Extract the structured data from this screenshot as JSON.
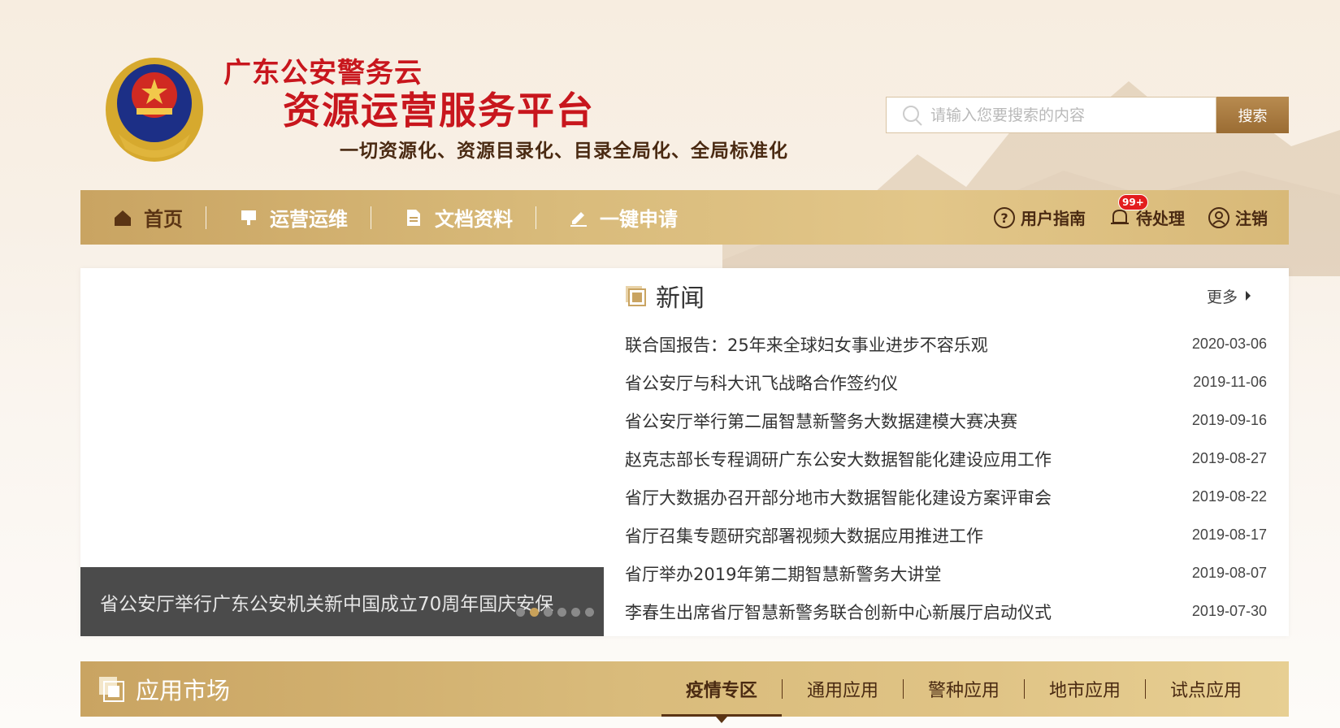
{
  "header": {
    "title_small": "广东公安警务云",
    "title_big": "资源运营服务平台",
    "slogan": "一切资源化、资源目录化、目录全局化、全局标准化",
    "emblem_icon": "police-emblem-icon"
  },
  "search": {
    "placeholder": "请输入您要搜索的内容",
    "button_label": "搜索"
  },
  "nav": {
    "items": [
      {
        "label": "首页",
        "icon": "home-icon"
      },
      {
        "label": "运营运维",
        "icon": "operations-icon"
      },
      {
        "label": "文档资料",
        "icon": "document-icon"
      },
      {
        "label": "一键申请",
        "icon": "apply-icon"
      }
    ],
    "right": {
      "guide_label": "用户指南",
      "pending_label": "待处理",
      "pending_badge": "99+",
      "logout_label": "注销"
    }
  },
  "carousel": {
    "caption": "省公安厅举行广东公安机关新中国成立70周年国庆安保",
    "dot_count": 6,
    "active_dot": 1
  },
  "news": {
    "title": "新闻",
    "more_label": "更多",
    "items": [
      {
        "title": "联合国报告：25年来全球妇女事业进步不容乐观",
        "date": "2020-03-06"
      },
      {
        "title": "省公安厅与科大讯飞战略合作签约仪",
        "date": "2019-11-06"
      },
      {
        "title": "省公安厅举行第二届智慧新警务大数据建模大赛决赛",
        "date": "2019-09-16"
      },
      {
        "title": "赵克志部长专程调研广东公安大数据智能化建设应用工作",
        "date": "2019-08-27"
      },
      {
        "title": "省厅大数据办召开部分地市大数据智能化建设方案评审会",
        "date": "2019-08-22"
      },
      {
        "title": "省厅召集专题研究部署视频大数据应用推进工作",
        "date": "2019-08-17"
      },
      {
        "title": "省厅举办2019年第二期智慧新警务大讲堂",
        "date": "2019-08-07"
      },
      {
        "title": "李春生出席省厅智慧新警务联合创新中心新展厅启动仪式",
        "date": "2019-07-30"
      }
    ]
  },
  "app_market": {
    "title": "应用市场",
    "tabs": [
      "疫情专区",
      "通用应用",
      "警种应用",
      "地市应用",
      "试点应用"
    ],
    "active_tab": 0
  },
  "colors": {
    "brand_red": "#c8161d",
    "gold": "#c9a462",
    "dark_brown": "#4a2a12"
  }
}
